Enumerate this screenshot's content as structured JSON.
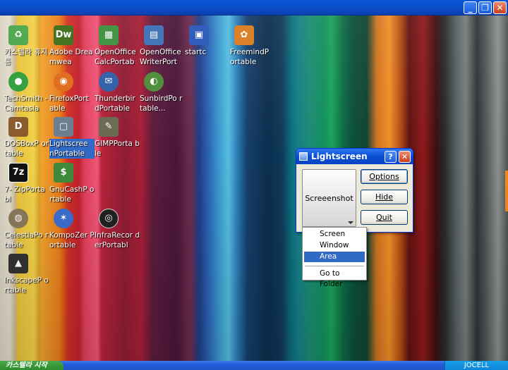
{
  "window_controls": {
    "minimize": "_",
    "restore": "❐",
    "close": "✕"
  },
  "desktop_icons": [
    {
      "label": "카스텔라 휴지통",
      "glyph": "♻",
      "color": "#4aa64a"
    },
    {
      "label": "Adobe Dreamwea",
      "glyph": "Dw",
      "color": "#3e6b17"
    },
    {
      "label": "OpenOffice CalcPortab",
      "glyph": "▦",
      "color": "#3b8f3b"
    },
    {
      "label": "OpenOffice WriterPort",
      "glyph": "▤",
      "color": "#3a6fb5"
    },
    {
      "label": "startc",
      "glyph": "▣",
      "color": "#2755b8"
    },
    {
      "label": "FreemindP ortable",
      "glyph": "✿",
      "color": "#d87a1e"
    },
    {
      "label": "TechSmith -Camtasia",
      "glyph": "●",
      "color": "#2f9e3a"
    },
    {
      "label": "FirefoxPort able",
      "glyph": "◉",
      "color": "#e06a1a"
    },
    {
      "label": "Thunderbir dPortable",
      "glyph": "✉",
      "color": "#2d5ea8"
    },
    {
      "label": "SunbirdPo rtable...",
      "glyph": "◐",
      "color": "#4c8d3a"
    },
    {
      "label": "DOSBoxP ortable",
      "glyph": "D",
      "color": "#8a5a2a"
    },
    {
      "label": "Lightscree nPortable",
      "glyph": "▢",
      "color": "#6a7e90"
    },
    {
      "label": "GIMPPorta ble",
      "glyph": "✎",
      "color": "#6a6a52"
    },
    {
      "label": "7- ZipPortabl",
      "glyph": "7z",
      "color": "#111111"
    },
    {
      "label": "GnuCashP ortable",
      "glyph": "$",
      "color": "#3f8a3a"
    },
    {
      "label": "CelestiaPo rtable",
      "glyph": "◍",
      "color": "#8a7a5a"
    },
    {
      "label": "KompoZer Portable",
      "glyph": "✶",
      "color": "#3c6fd0"
    },
    {
      "label": "InfraRecor derPortabl",
      "glyph": "◎",
      "color": "#222222"
    },
    {
      "label": "InkscapeP ortable",
      "glyph": "▲",
      "color": "#333333"
    }
  ],
  "lightscreen": {
    "title": "Lightscreen",
    "help": "?",
    "close": "✕",
    "screenshot_label": "Screeenshot",
    "options_label": "Options",
    "hide_label": "Hide",
    "quit_label": "Quit"
  },
  "screenshot_menu": {
    "items": [
      "Screen",
      "Window",
      "Area",
      "Go to Folder"
    ],
    "highlighted": "Area"
  },
  "taskbar": {
    "start_label": "카스텔라 시작",
    "tray_label": "JOCELL"
  }
}
